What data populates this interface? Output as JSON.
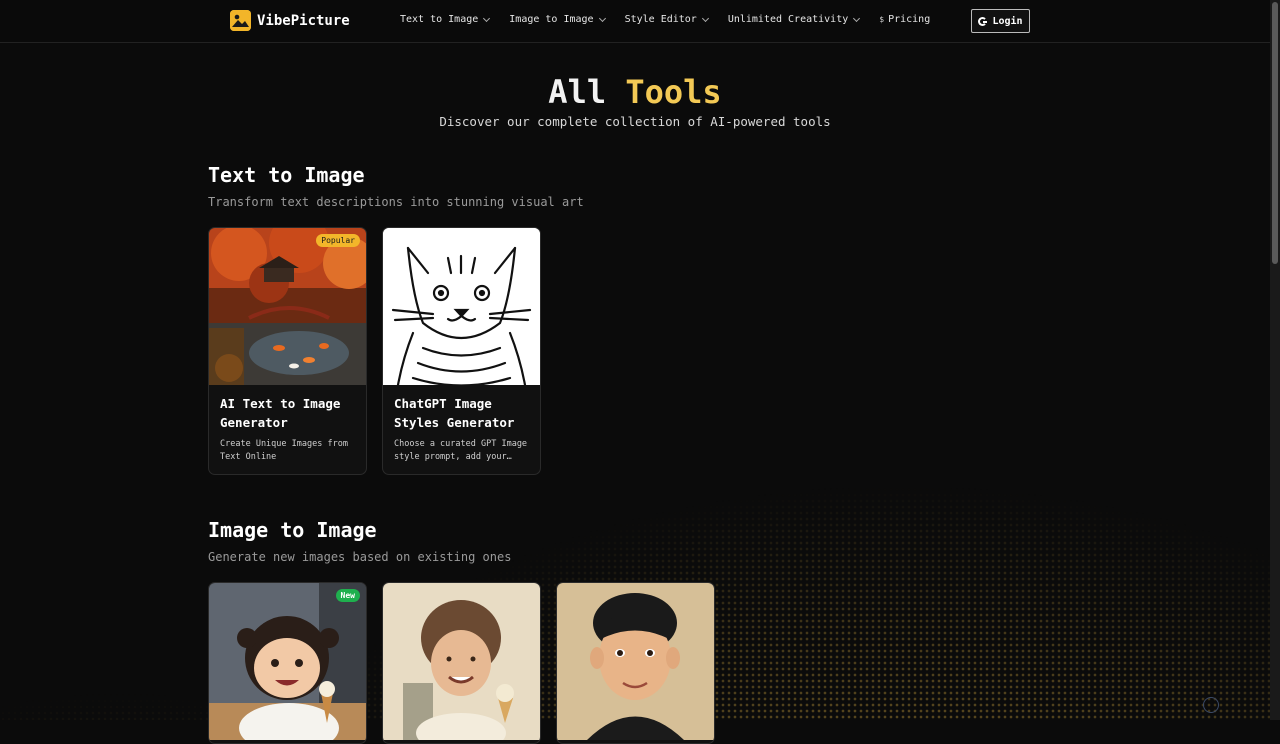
{
  "brand": {
    "name": "VibePicture"
  },
  "nav": {
    "items": [
      {
        "label": "Text to Image",
        "has_dropdown": true
      },
      {
        "label": "Image to Image",
        "has_dropdown": true
      },
      {
        "label": "Style Editor",
        "has_dropdown": true
      },
      {
        "label": "Unlimited Creativity",
        "has_dropdown": true
      },
      {
        "label": "Pricing",
        "icon": "dollar-icon",
        "has_dropdown": false
      }
    ],
    "login_label": "Login"
  },
  "hero": {
    "title_main": "All",
    "title_accent": "Tools",
    "subtitle": "Discover our complete collection of AI-powered tools"
  },
  "sections": [
    {
      "title": "Text to Image",
      "subtitle": "Transform text descriptions into stunning visual art",
      "cards": [
        {
          "title": "AI Text to Image Generator",
          "description": "Create Unique Images from Text Online",
          "badge": "Popular",
          "image": "autumn-japanese-garden"
        },
        {
          "title": "ChatGPT Image Styles Generator",
          "description": "Choose a curated GPT Image style prompt, add your idea…",
          "badge": "",
          "image": "cat-line-drawing"
        }
      ]
    },
    {
      "title": "Image to Image",
      "subtitle": "Generate new images based on existing ones",
      "cards": [
        {
          "title": "",
          "description": "",
          "badge": "New",
          "image": "3d-cartoon-girl-ice-cream"
        },
        {
          "title": "",
          "description": "",
          "badge": "",
          "image": "sketch-girl-ice-cream"
        },
        {
          "title": "",
          "description": "",
          "badge": "",
          "image": "3d-cartoon-man-portrait"
        }
      ]
    }
  ],
  "colors": {
    "accent": "#f3c955",
    "background": "#0b0b0b",
    "badge_popular": "#f3b62a",
    "badge_new": "#1fb04e"
  }
}
